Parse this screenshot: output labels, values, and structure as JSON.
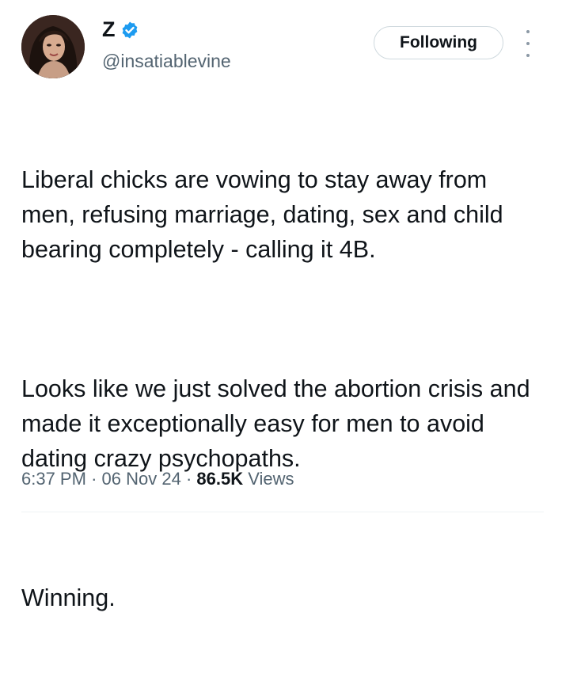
{
  "author": {
    "display_name": "Z",
    "handle": "@insatiablevine",
    "verified_icon": "verified-badge-icon",
    "verified_color": "#1d9bf0"
  },
  "actions": {
    "follow_label": "Following",
    "more_icon": "more-vertical-icon"
  },
  "tweet": {
    "paragraphs": [
      "Liberal chicks are vowing to stay away from men, refusing marriage, dating, sex and child bearing completely - calling it 4B.",
      "Looks like we just solved the abortion crisis and made it exceptionally easy for men to avoid dating crazy psychopaths.",
      "Winning."
    ],
    "time": "6:37 PM",
    "separator": "·",
    "date": "06 Nov 24",
    "views_count": "86.5K",
    "views_label": "Views"
  }
}
